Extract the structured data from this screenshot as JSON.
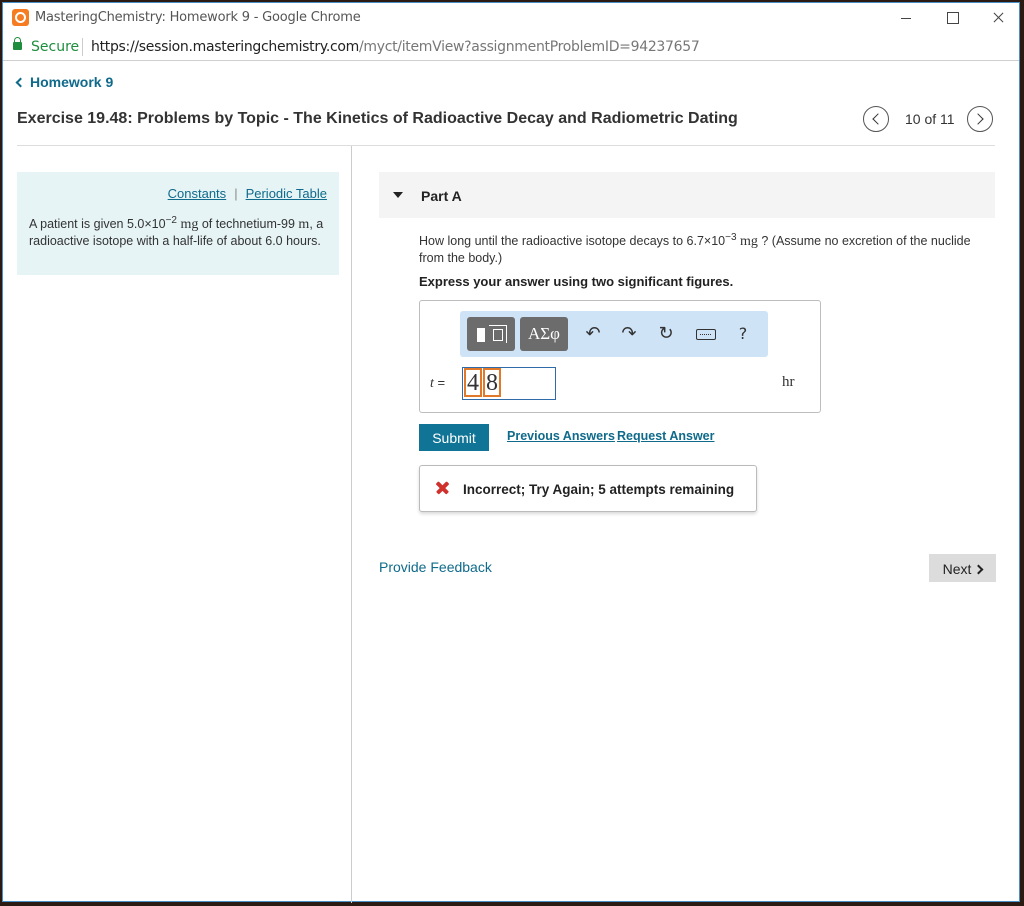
{
  "window": {
    "title": "MasteringChemistry: Homework 9 - Google Chrome"
  },
  "address_bar": {
    "secure_label": "Secure",
    "url_host": "https://session.masteringchemistry.com",
    "url_path": "/myct/itemView?assignmentProblemID=94237657"
  },
  "nav": {
    "back_label": "Homework 9",
    "page_title": "Exercise 19.48: Problems by Topic - The Kinetics of Radioactive Decay and Radiometric Dating",
    "pager_text": "10 of 11"
  },
  "info": {
    "constants_link": "Constants",
    "separator": "|",
    "periodic_table_link": "Periodic Table",
    "text_1": "A patient is given 5.0×10",
    "exp_1": "−2",
    "unit_1": " mg",
    "text_2": " of technetium-99 ",
    "unit_2": "m",
    "text_3": ", a radioactive isotope with a half-life of about 6.0 hours."
  },
  "part": {
    "label": "Part A",
    "question_1": "How long until the radioactive isotope decays to 6.7×10",
    "question_exp": "−3",
    "question_unit": " mg",
    "question_2": " ? (Assume no excretion of the nuclide from the body.)",
    "instruction": "Express your answer using two significant figures."
  },
  "answer": {
    "toolbar_greek": "ΑΣφ",
    "toolbar_undo": "↶",
    "toolbar_redo": "↷",
    "toolbar_reset": "↻",
    "toolbar_help": "?",
    "variable": "t",
    "equals": " =",
    "digit_1": "4",
    "digit_2": "8",
    "unit": "hr"
  },
  "actions": {
    "submit_label": "Submit",
    "previous_answers": "Previous Answers",
    "request_answer": "Request Answer"
  },
  "feedback": {
    "message": "Incorrect; Try Again; 5 attempts remaining"
  },
  "footer": {
    "provide_feedback": "Provide Feedback",
    "next_label": "Next"
  }
}
